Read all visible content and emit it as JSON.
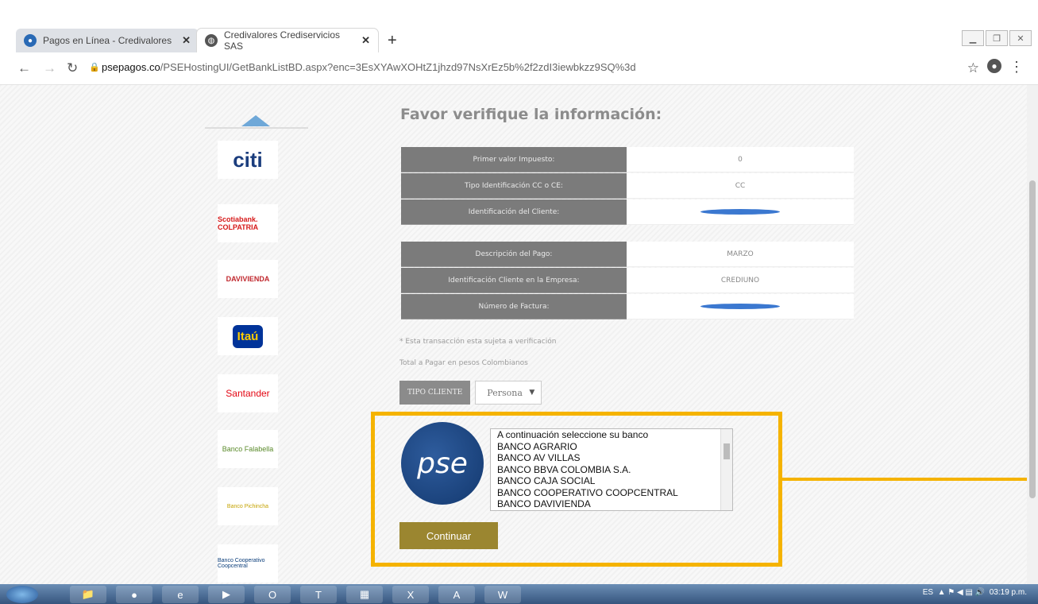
{
  "browser": {
    "tabs": [
      {
        "title": "Pagos en Línea - Credivalores"
      },
      {
        "title": "Credivalores Crediservicios SAS"
      }
    ],
    "url_host": "psepagos.co",
    "url_path": "/PSEHostingUI/GetBankListBD.aspx?enc=3EsXYAwXOHtZ1jhzd97NsXrEz5b%2f2zdI3iewbkzz9SQ%3d"
  },
  "page": {
    "title": "Favor verifique la información:",
    "group1": [
      {
        "label": "Primer valor Impuesto:",
        "value": "0"
      },
      {
        "label": "Tipo Identificación CC o CE:",
        "value": "CC"
      },
      {
        "label": "Identificación del Cliente:",
        "value": ""
      }
    ],
    "group2": [
      {
        "label": "Descripción del Pago:",
        "value": "MARZO"
      },
      {
        "label": "Identificación Cliente en la Empresa:",
        "value": "CREDIUNO"
      },
      {
        "label": "Número de Factura:",
        "value": ""
      }
    ],
    "note1": "* Esta transacción esta sujeta a verificación",
    "note2": "Total a Pagar en pesos Colombianos",
    "tipo_cliente_label": "TIPO CLIENTE",
    "tipo_cliente_value": "Persona",
    "pse_logo_text": "pse",
    "bank_list": [
      "A continuación seleccione su banco",
      "BANCO AGRARIO",
      "BANCO AV VILLAS",
      "BANCO BBVA COLOMBIA S.A.",
      "BANCO CAJA SOCIAL",
      "BANCO COOPERATIVO COOPCENTRAL",
      "BANCO DAVIVIENDA"
    ],
    "continue_label": "Continuar"
  },
  "bank_logos": [
    "citi",
    "Scotiabank. COLPATRIA",
    "DAVIVIENDA",
    "Itaú",
    "Santander",
    "Banco Falabella",
    "Banco Pichincha",
    "Banco Cooperativo Coopcentral"
  ],
  "taskbar": {
    "lang": "ES",
    "time": "03:19 p.m."
  },
  "colors": {
    "highlight": "#f5b300",
    "label_bg": "#7b7b7b",
    "button": "#9b8630"
  }
}
